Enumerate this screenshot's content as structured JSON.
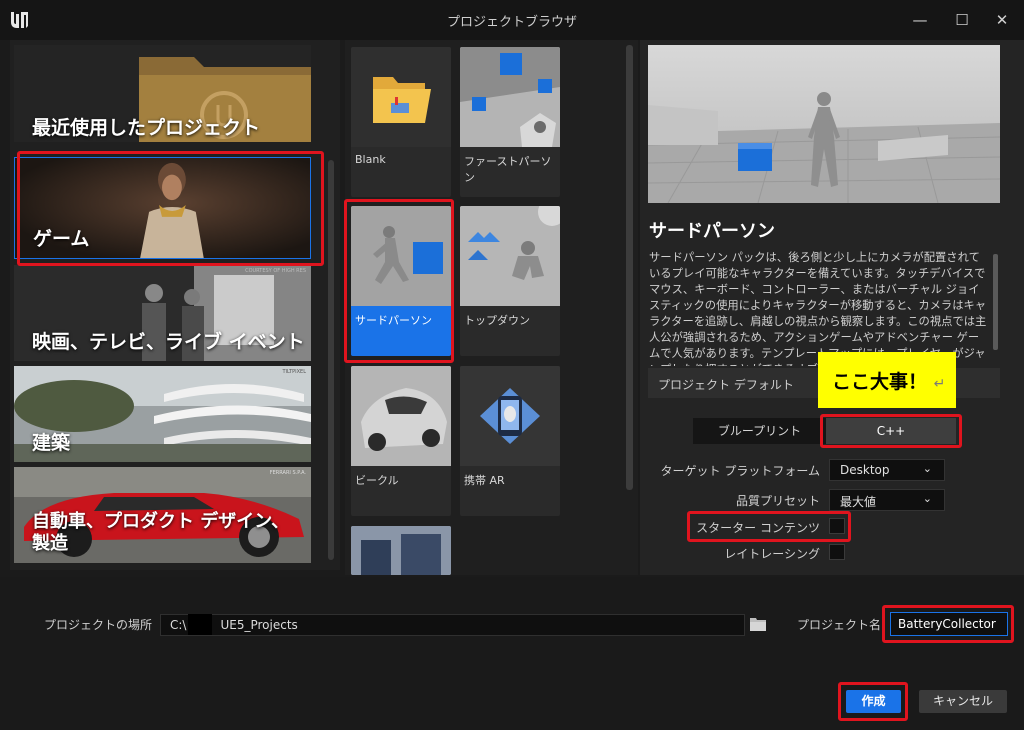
{
  "window": {
    "title": "プロジェクトブラウザ",
    "logo_icon": "unreal-logo-icon",
    "controls": {
      "minimize": "—",
      "maximize": "☐",
      "close": "✕"
    }
  },
  "categories": [
    {
      "label": "最近使用したプロジェクト",
      "selected": false
    },
    {
      "label": "ゲーム",
      "selected": true
    },
    {
      "label": "映画、テレビ、ライブ イベント",
      "selected": false,
      "watermark": "COURTESY OF HIGH RES"
    },
    {
      "label": "建築",
      "selected": false,
      "watermark": "TILTPIXEL"
    },
    {
      "label": "自動車、プロダクト デザイン、製造",
      "selected": false,
      "watermark": "FERRARI S.P.A."
    }
  ],
  "templates": [
    {
      "label": "Blank"
    },
    {
      "label": "ファーストパーソン"
    },
    {
      "label": "サードパーソン",
      "selected": true
    },
    {
      "label": "トップダウン"
    },
    {
      "label": "ビークル"
    },
    {
      "label": "携帯 AR"
    },
    {
      "label": ""
    }
  ],
  "detail": {
    "title": "サードパーソン",
    "description": "サードパーソン パックは、後ろ側と少し上にカメラが配置されているプレイ可能なキャラクターを備えています。タッチデバイスでマウス、キーボード、コントローラー、またはバーチャル ジョイスティックの使用によりキャラクターが移動すると、カメラはキャラクターを追跡し、肩越しの視点から観察します。この視点では主人公が強調されるため、アクションゲームやアドベンチャー ゲームで人気があります。テンプレートマップには、プレイヤーがジャンプしたり押すことができるオブジェクトがいくつ",
    "section_header": "プロジェクト デフォルト",
    "callout": "ここ大事！",
    "callout_mark": "↵",
    "language": {
      "blueprint": "ブループリント",
      "cpp": "C++",
      "selected": "C++"
    },
    "target_platform": {
      "label": "ターゲット プラットフォーム",
      "value": "Desktop"
    },
    "quality_preset": {
      "label": "品質プリセット",
      "value": "最大値"
    },
    "starter_content": {
      "label": "スターター コンテンツ",
      "checked": false
    },
    "raytracing": {
      "label": "レイトレーシング",
      "checked": false
    }
  },
  "bottom": {
    "location_label": "プロジェクトの場所",
    "location_prefix": "C:\\",
    "location_suffix": "UE5_Projects",
    "name_label": "プロジェクト名",
    "name_value": "BatteryCollector",
    "create_label": "作成",
    "cancel_label": "キャンセル"
  },
  "colors": {
    "accent": "#1a73e8",
    "highlight_box": "#e0141e",
    "callout": "#ffff00"
  }
}
